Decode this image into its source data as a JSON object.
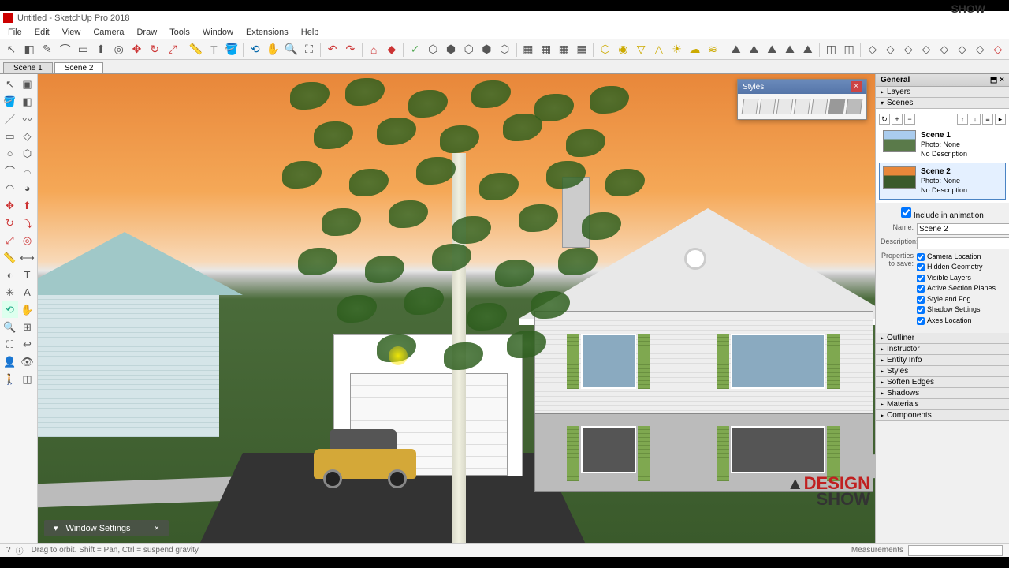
{
  "title": "Untitled - SketchUp Pro 2018",
  "menu": [
    "File",
    "Edit",
    "View",
    "Camera",
    "Draw",
    "Tools",
    "Window",
    "Extensions",
    "Help"
  ],
  "scene_tabs": [
    "Scene 1",
    "Scene 2"
  ],
  "active_scene_tab": 1,
  "styles_panel": {
    "title": "Styles"
  },
  "window_settings_bar": "Window Settings",
  "tray": {
    "header": "General",
    "sections_top": [
      "Layers",
      "Scenes"
    ],
    "sections_bottom": [
      "Outliner",
      "Instructor",
      "Entity Info",
      "Styles",
      "Soften Edges",
      "Shadows",
      "Materials",
      "Components"
    ]
  },
  "scenes": [
    {
      "name": "Scene 1",
      "photo": "Photo: None",
      "desc": "No Description"
    },
    {
      "name": "Scene 2",
      "photo": "Photo: None",
      "desc": "No Description"
    }
  ],
  "selected_scene": 1,
  "scene_props": {
    "include_label": "Include in animation",
    "name_label": "Name:",
    "name_value": "Scene 2",
    "desc_label": "Description:",
    "props_label": "Properties to save:",
    "checks": [
      "Camera Location",
      "Hidden Geometry",
      "Visible Layers",
      "Active Section Planes",
      "Style and Fog",
      "Shadow Settings",
      "Axes Location"
    ]
  },
  "status": {
    "hint": "Drag to orbit. Shift = Pan, Ctrl = suspend gravity.",
    "measure_label": "Measurements"
  },
  "watermark": {
    "line1": "DESIGN",
    "line2": "SHOW"
  }
}
